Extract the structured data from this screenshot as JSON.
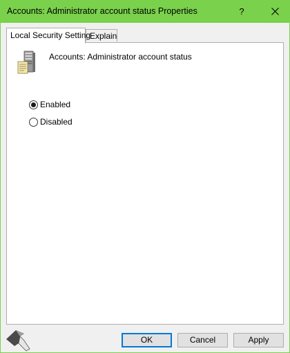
{
  "window": {
    "title": "Accounts: Administrator account status Properties",
    "help_label": "?"
  },
  "tabs": [
    {
      "label": "Local Security Setting",
      "active": true
    },
    {
      "label": "Explain",
      "active": false
    }
  ],
  "policy": {
    "title": "Accounts: Administrator account status",
    "icon": "server-policy-icon"
  },
  "options": [
    {
      "label": "Enabled",
      "checked": true
    },
    {
      "label": "Disabled",
      "checked": false
    }
  ],
  "buttons": {
    "ok": "OK",
    "cancel": "Cancel",
    "apply": "Apply"
  },
  "colors": {
    "titlebar": "#7ad14c",
    "accent_focus": "#0078d7",
    "client": "#f0f0f0"
  },
  "watermark": {
    "icon": "hammer-logo-icon"
  }
}
